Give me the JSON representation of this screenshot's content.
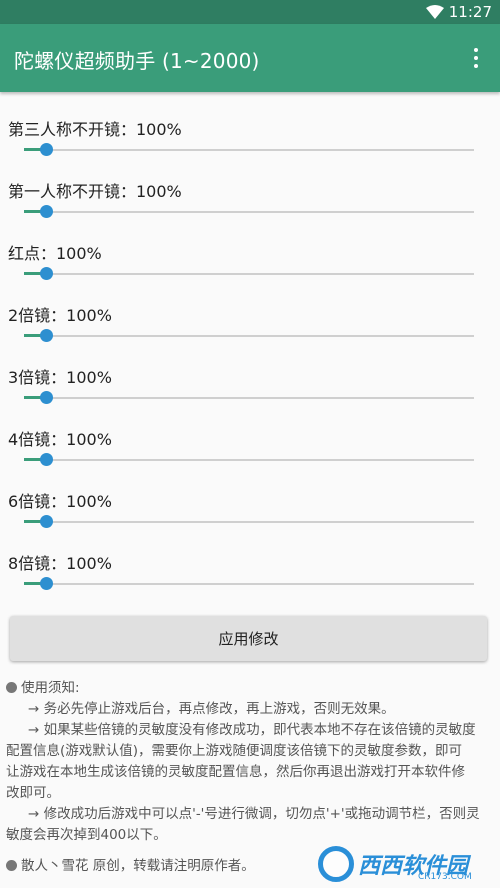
{
  "status_bar": {
    "time": "11:27",
    "wifi_icon": "wifi-icon",
    "battery_icon": "battery-icon"
  },
  "app_bar": {
    "title": "陀螺仪超频助手 (1~2000)",
    "menu_icon": "more-vert-icon"
  },
  "sliders": [
    {
      "label": "第三人称不开镜：100%",
      "level": 0.05
    },
    {
      "label": "第一人称不开镜：100%",
      "level": 0.05
    },
    {
      "label": "红点：100%",
      "level": 0.05
    },
    {
      "label": "2倍镜：100%",
      "level": 0.05
    },
    {
      "label": "3倍镜：100%",
      "level": 0.05
    },
    {
      "label": "4倍镜：100%",
      "level": 0.05
    },
    {
      "label": "6倍镜：100%",
      "level": 0.05
    },
    {
      "label": "8倍镜：100%",
      "level": 0.05
    }
  ],
  "apply_button": "应用修改",
  "notes": {
    "heading": "使用须知:",
    "item1": "→ 务必先停止游戏后台，再点修改，再上游戏，否则无效果。",
    "item2_line1": "→ 如果某些倍镜的灵敏度没有修改成功，即代表本地不存在该倍镜的灵敏度",
    "item2_line2": "配置信息(游戏默认值)，需要你上游戏随便调度该倍镜下的灵敏度参数，即可",
    "item2_line3": "让游戏在本地生成该倍镜的灵敏度配置信息，然后你再退出游戏打开本软件修",
    "item2_line4": "改即可。",
    "item3_line1": "→ 修改成功后游戏中可以点'-'号进行微调，切勿点'+'或拖动调节栏，否则灵",
    "item3_line2": "敏度会再次掉到400以下。",
    "footer": "散人丶雪花 原创，转载请注明原作者。"
  },
  "watermark": {
    "brand": "西西软件园",
    "sub": "CR173.COM"
  },
  "colors": {
    "status_bar": "#2f7e62",
    "app_bar": "#3a9d7a",
    "thumb": "#2d8fd0"
  }
}
